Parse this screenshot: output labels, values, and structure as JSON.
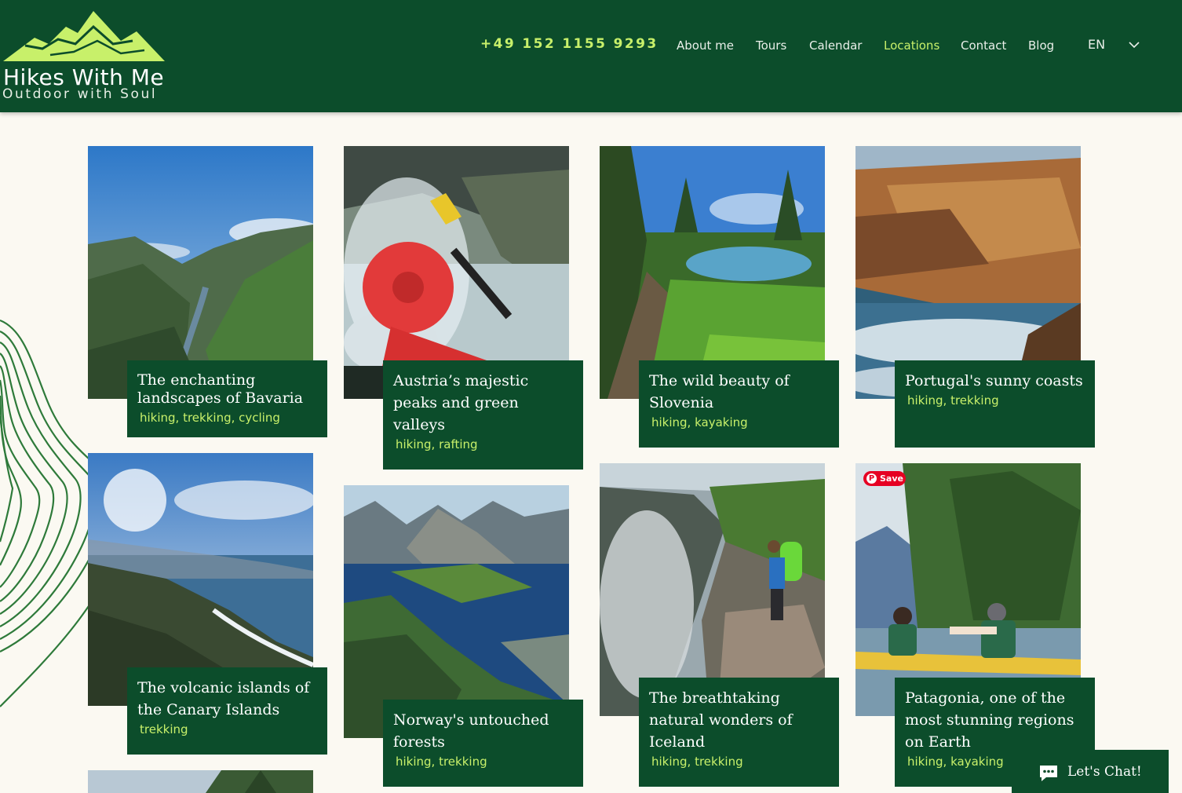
{
  "brand": {
    "title": "Hikes With Me",
    "tagline": "Outdoor with Soul",
    "logo_icon": "mountain-logo-icon"
  },
  "header": {
    "phone": "+49 152 1155 9293",
    "nav": [
      {
        "label": "About me"
      },
      {
        "label": "Tours"
      },
      {
        "label": "Calendar"
      },
      {
        "label": "Locations",
        "active": true
      },
      {
        "label": "Contact"
      },
      {
        "label": "Blog"
      }
    ],
    "language": "EN",
    "language_icon": "chevron-down-icon"
  },
  "locations": [
    {
      "title": "The enchanting landscapes of Bavaria",
      "tags": "hiking, trekking, cycling"
    },
    {
      "title": "Austria’s majestic peaks and green valleys",
      "tags": "hiking, rafting"
    },
    {
      "title": "The wild beauty of Slovenia",
      "tags": "hiking, kayaking"
    },
    {
      "title": "Portugal's sunny coasts",
      "tags": "hiking, trekking"
    },
    {
      "title": "The volcanic islands of the Canary Islands",
      "tags": "trekking"
    },
    {
      "title": "Norway's untouched forests",
      "tags": "hiking, trekking"
    },
    {
      "title": "The breathtaking natural wonders of Iceland",
      "tags": "hiking, trekking"
    },
    {
      "title": "Patagonia, one of the most stunning regions on Earth",
      "tags": "hiking, kayaking"
    }
  ],
  "pinterest": {
    "label": "Save",
    "icon": "pinterest-icon"
  },
  "chat": {
    "label": "Let's Chat!",
    "icon": "chat-bubble-icon"
  },
  "colors": {
    "header_bg": "#0c4d2b",
    "accent": "#c8f06a",
    "page_bg": "#fbf9f2"
  }
}
